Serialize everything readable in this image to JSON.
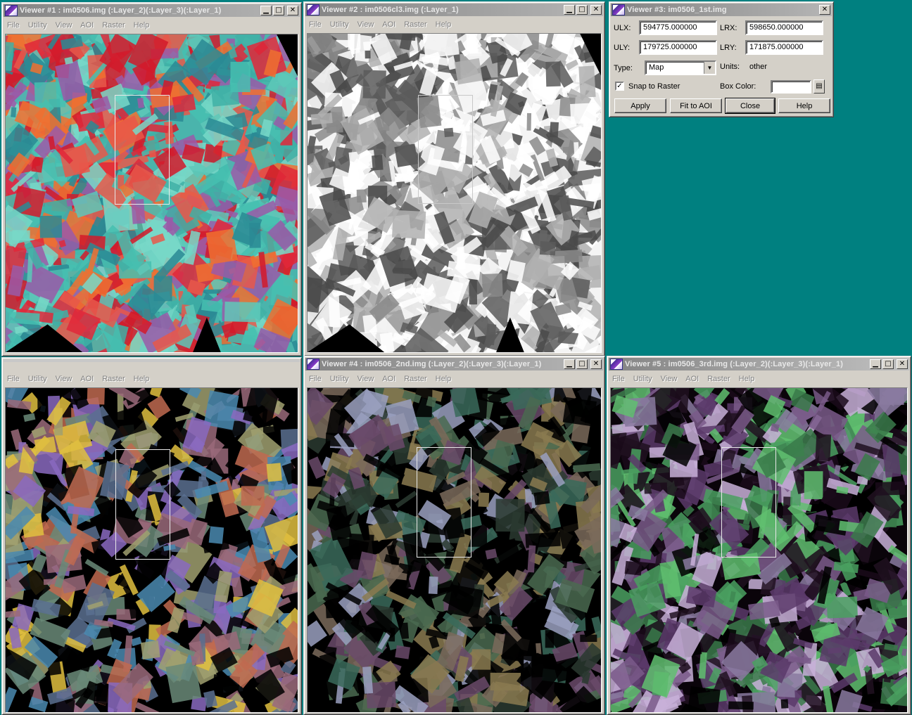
{
  "desktop_bg": "#008080",
  "menu": [
    "File",
    "Utility",
    "View",
    "AOI",
    "Raster",
    "Help"
  ],
  "viewers": [
    {
      "id": "v1",
      "title": "Viewer #1 : im0506.img (:Layer_2)(:Layer_3)(:Layer_1)",
      "palette": "false-color-red-cyan"
    },
    {
      "id": "v2",
      "title": "Viewer #2 : im0506cl3.img (:Layer_1)",
      "palette": "classified-gray-white"
    },
    {
      "id": "v4",
      "title": "Viewer #4 : im0506_2nd.img (:Layer_2)(:Layer_3)(:Layer_1)",
      "palette": "dark-multicolor"
    },
    {
      "id": "v5",
      "title": "Viewer #5 : im0506_3rd.img (:Layer_2)(:Layer_3)(:Layer_1)",
      "palette": "dark-purple-green"
    },
    {
      "id": "v6",
      "title": "",
      "palette": "dark-colored-fields"
    }
  ],
  "dialog": {
    "title": "Viewer #3: im0506_1st.img",
    "ulx_label": "ULX:",
    "ulx": "594775.000000",
    "lrx_label": "LRX:",
    "lrx": "598650.000000",
    "uly_label": "ULY:",
    "uly": "179725.000000",
    "lry_label": "LRY:",
    "lry": "171875.000000",
    "type_label": "Type:",
    "type_value": "Map",
    "units_label": "Units:",
    "units_value": "other",
    "snap_label": "Snap to Raster",
    "snap_checked": true,
    "box_color_label": "Box Color:",
    "buttons": {
      "apply": "Apply",
      "fit": "Fit to AOI",
      "close": "Close",
      "help": "Help"
    }
  }
}
